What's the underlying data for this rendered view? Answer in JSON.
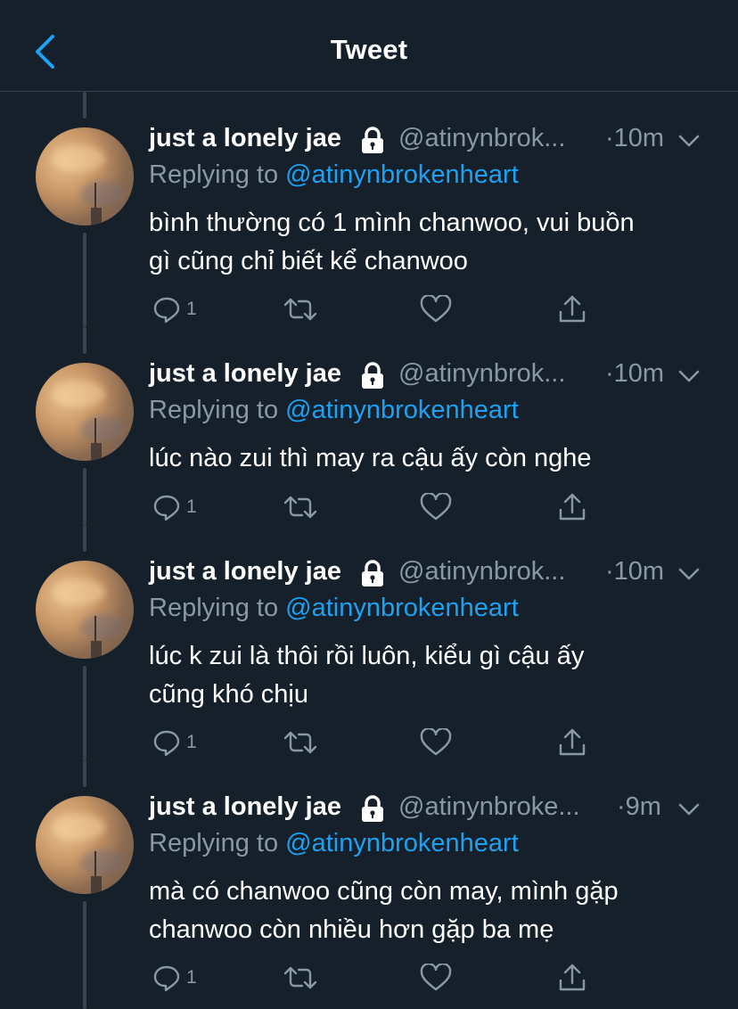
{
  "header": {
    "title": "Tweet"
  },
  "colors": {
    "background": "#15202b",
    "muted": "#8899a6",
    "link": "#1da1f2",
    "divider": "#38444d"
  },
  "tweets": [
    {
      "name": "just a lonely jae",
      "handle": "@atinynbrok...",
      "time": "·10m",
      "replying_prefix": "Replying to",
      "replying_to": "@atinynbrokenheart",
      "lines": [
        "bình thường có 1 mình chanwoo, vui buồn",
        "gì cũng chỉ biết kể chanwoo"
      ],
      "reply_count": "1"
    },
    {
      "name": "just a lonely jae",
      "handle": "@atinynbrok...",
      "time": "·10m",
      "replying_prefix": "Replying to",
      "replying_to": "@atinynbrokenheart",
      "lines": [
        "lúc nào zui thì may ra cậu ấy còn nghe"
      ],
      "reply_count": "1"
    },
    {
      "name": "just a lonely jae",
      "handle": "@atinynbrok...",
      "time": "·10m",
      "replying_prefix": "Replying to",
      "replying_to": "@atinynbrokenheart",
      "lines": [
        "lúc k zui là thôi rồi luôn, kiểu gì cậu ấy",
        "cũng khó chịu"
      ],
      "reply_count": "1"
    },
    {
      "name": "just a lonely jae",
      "handle": "@atinynbroke...",
      "time": "·9m",
      "replying_prefix": "Replying to",
      "replying_to": "@atinynbrokenheart",
      "lines": [
        "mà có chanwoo cũng còn may, mình gặp",
        "chanwoo còn nhiều hơn gặp ba mẹ"
      ],
      "reply_count": "1"
    }
  ]
}
